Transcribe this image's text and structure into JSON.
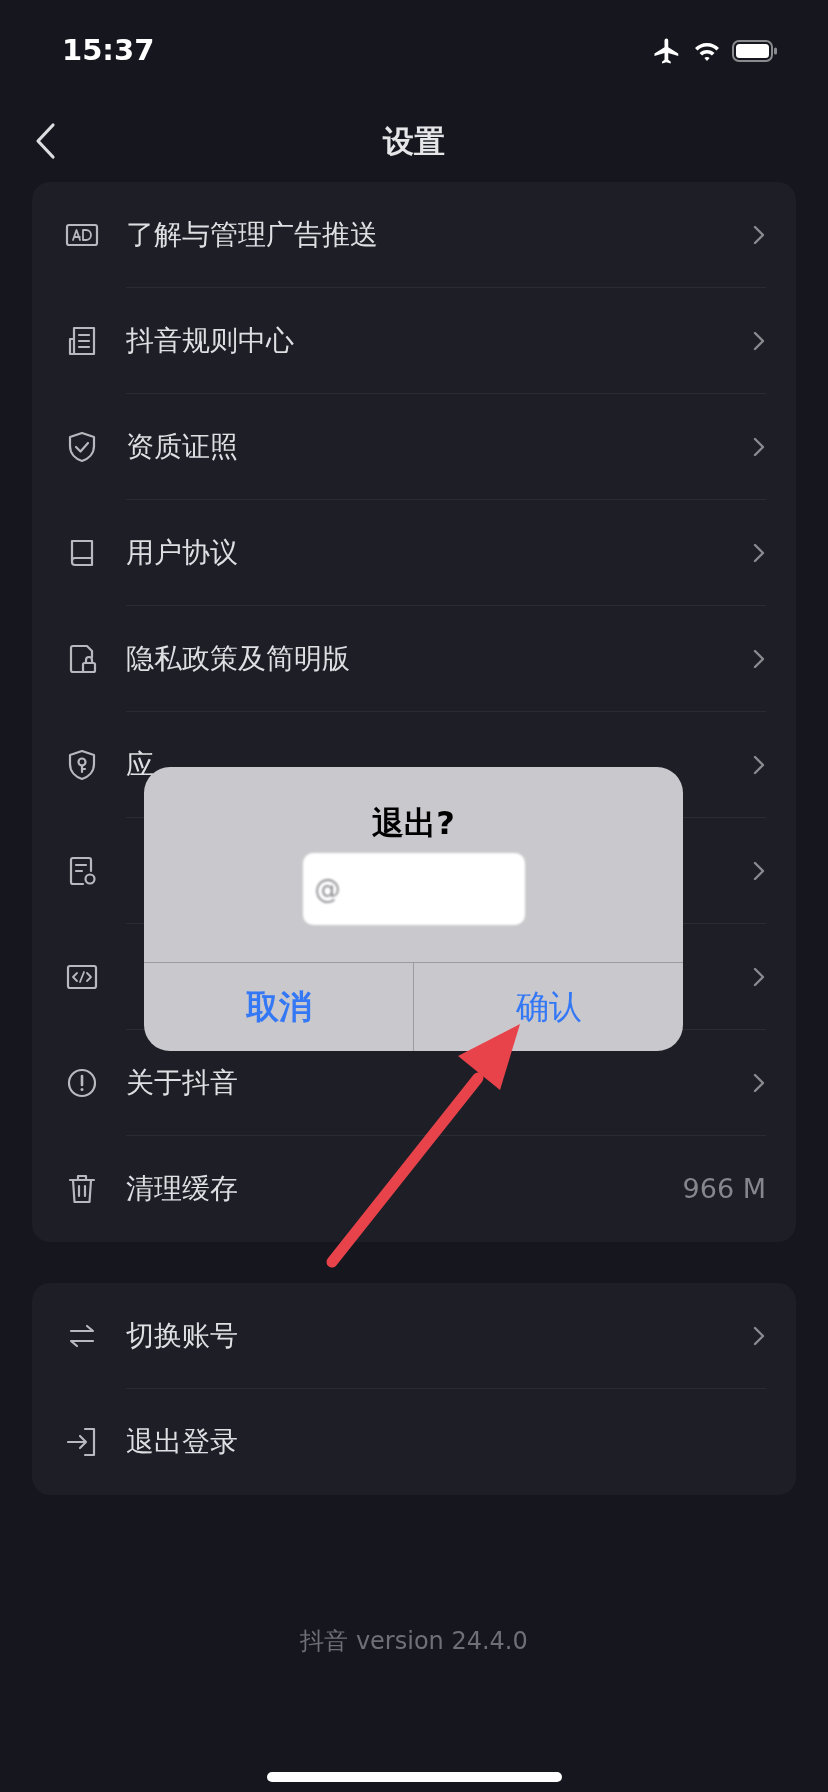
{
  "status_bar": {
    "time": "15:37"
  },
  "header": {
    "title": "设置"
  },
  "settings_card": [
    {
      "label": "了解与管理广告推送",
      "chevron": true
    },
    {
      "label": "抖音规则中心",
      "chevron": true
    },
    {
      "label": "资质证照",
      "chevron": true
    },
    {
      "label": "用户协议",
      "chevron": true
    },
    {
      "label": "隐私政策及简明版",
      "chevron": true
    },
    {
      "label": "应",
      "chevron": true
    },
    {
      "chevron": true
    },
    {
      "chevron": true
    },
    {
      "label": "关于抖音",
      "chevron": true
    },
    {
      "label": "清理缓存",
      "value": "966 M"
    }
  ],
  "account_card": [
    {
      "label": "切换账号",
      "chevron": true
    },
    {
      "label": "退出登录",
      "chevron": false
    }
  ],
  "footer": {
    "version": "抖音 version 24.4.0"
  },
  "dialog": {
    "title": "退出?",
    "subtitle": "@",
    "buttons": [
      {
        "label": "取消",
        "bold": true
      },
      {
        "label": "确认",
        "bold": false
      }
    ]
  }
}
